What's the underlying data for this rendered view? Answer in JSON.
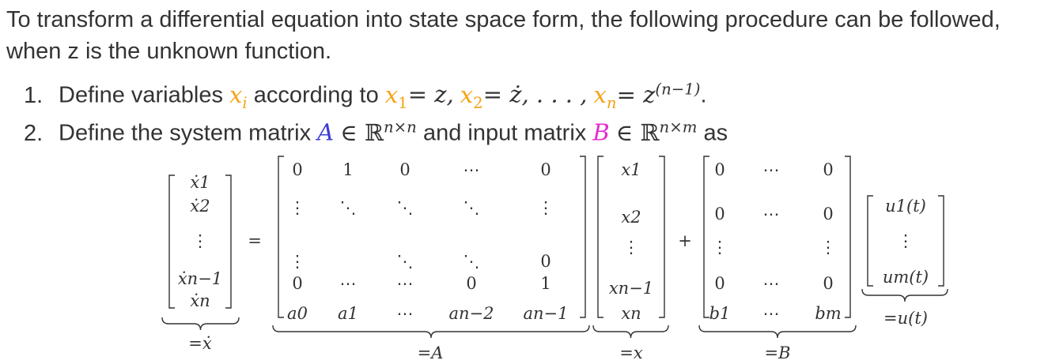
{
  "intro_text": "To transform a differential equation into state space form, the following procedure can be followed, when z is the unknown function.",
  "step1": {
    "number": "1.",
    "text_before": "Define variables",
    "var": "x",
    "var_sub": "i",
    "text_mid": "according to",
    "x1": "x",
    "x1_sub": "1",
    "eq1": "= z,",
    "x2": "x",
    "x2_sub": "2",
    "eq2": "= ż, . . . ,",
    "xn": "x",
    "xn_sub": "n",
    "eq3": "= z",
    "eq3_sup": "(n−1)",
    "end": "."
  },
  "step2": {
    "number": "2.",
    "text_before": "Define the system matrix",
    "A": "A",
    "in1": "∈ ℝ",
    "dim1": "n×n",
    "text_mid": "and input matrix",
    "B": "B",
    "in2": "∈ ℝ",
    "dim2": "n×m",
    "text_end": "as"
  },
  "equation": {
    "xdot_vector": [
      "ẋ1",
      "ẋ2",
      "⋮",
      "ẋn−1",
      "ẋn"
    ],
    "equals": "=",
    "plus": "+",
    "A_matrix": [
      [
        "0",
        "1",
        "0",
        "⋯",
        "0"
      ],
      [
        "⋮",
        "⋱",
        "⋱",
        "⋱",
        "⋮"
      ],
      [
        "⋮",
        "",
        "⋱",
        "⋱",
        "0"
      ],
      [
        "0",
        "⋯",
        "⋯",
        "0",
        "1"
      ],
      [
        "a0",
        "a1",
        "⋯",
        "an−2",
        "an−1"
      ]
    ],
    "x_vector": [
      "x1",
      "x2",
      "⋮",
      "xn−1",
      "xn"
    ],
    "B_matrix": [
      [
        "0",
        "⋯",
        "0"
      ],
      [
        "0",
        "⋯",
        "0"
      ],
      [
        "⋮",
        "",
        "⋮"
      ],
      [
        "0",
        "⋯",
        "0"
      ],
      [
        "b1",
        "⋯",
        "bm"
      ]
    ],
    "u_vector": [
      "u1(t)",
      "⋮",
      "um(t)"
    ],
    "labels": {
      "xdot": "=ẋ",
      "A": "=A",
      "x": "=x",
      "B": "=B",
      "u": "=u(t)"
    },
    "colors": {
      "orange": "#f5a316",
      "blue": "#3b3fd6",
      "magenta": "#e62bd0",
      "green": "#6cc04a"
    }
  }
}
